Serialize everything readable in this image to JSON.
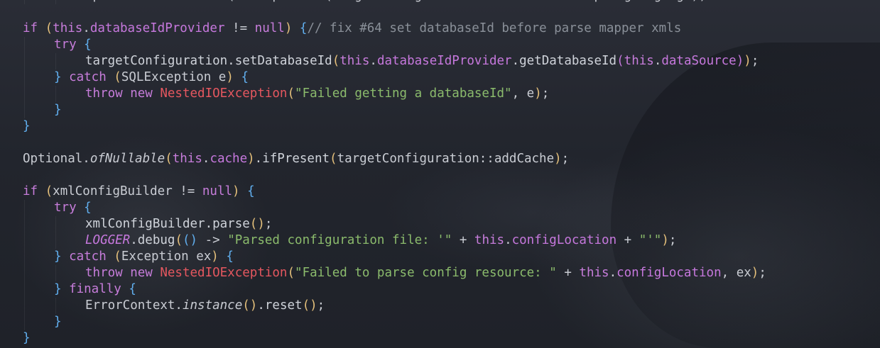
{
  "editor": {
    "lines": [
      {
        "indent": 2,
        "tokens": [
          {
            "t": "Optional.ofNullable(this.",
            "c": "t-plain"
          },
          {
            "t": "present(targetConfiguration::setDefaultScriptingLanguage);",
            "c": "t-plain"
          }
        ]
      },
      {
        "indent": 0,
        "tokens": []
      },
      {
        "indent": 0,
        "tokens": [
          {
            "t": "if ",
            "c": "t-kw"
          },
          {
            "t": "(",
            "c": "p1"
          },
          {
            "t": "this",
            "c": "t-kw"
          },
          {
            "t": ".",
            "c": "t-plain"
          },
          {
            "t": "databaseIdProvider",
            "c": "t-field"
          },
          {
            "t": " != ",
            "c": "t-plain"
          },
          {
            "t": "null",
            "c": "t-kw"
          },
          {
            "t": ") ",
            "c": "p1"
          },
          {
            "t": "{",
            "c": "brace"
          },
          {
            "t": "// fix #64 set databaseId before parse mapper xmls",
            "c": "t-comment"
          }
        ]
      },
      {
        "indent": 1,
        "tokens": [
          {
            "t": "try ",
            "c": "t-kw"
          },
          {
            "t": "{",
            "c": "brace"
          }
        ]
      },
      {
        "indent": 2,
        "tokens": [
          {
            "t": "targetConfiguration.setDatabaseId",
            "c": "t-fn"
          },
          {
            "t": "(",
            "c": "p1"
          },
          {
            "t": "this",
            "c": "t-kw"
          },
          {
            "t": ".",
            "c": "t-plain"
          },
          {
            "t": "databaseIdProvider",
            "c": "t-field"
          },
          {
            "t": ".getDatabaseId",
            "c": "t-fn"
          },
          {
            "t": "(",
            "c": "p2"
          },
          {
            "t": "this",
            "c": "t-kw"
          },
          {
            "t": ".",
            "c": "t-plain"
          },
          {
            "t": "dataSource",
            "c": "t-field"
          },
          {
            "t": ")",
            "c": "p2"
          },
          {
            "t": ")",
            "c": "p1"
          },
          {
            "t": ";",
            "c": "t-plain"
          }
        ]
      },
      {
        "indent": 1,
        "tokens": [
          {
            "t": "} ",
            "c": "brace"
          },
          {
            "t": "catch ",
            "c": "t-kw"
          },
          {
            "t": "(",
            "c": "p1"
          },
          {
            "t": "SQLException e",
            "c": "t-plain"
          },
          {
            "t": ") ",
            "c": "p1"
          },
          {
            "t": "{",
            "c": "brace"
          }
        ]
      },
      {
        "indent": 2,
        "tokens": [
          {
            "t": "throw new ",
            "c": "t-kw"
          },
          {
            "t": "NestedIOException",
            "c": "t-cls"
          },
          {
            "t": "(",
            "c": "p1"
          },
          {
            "t": "\"Failed getting a databaseId\"",
            "c": "t-str"
          },
          {
            "t": ", e",
            "c": "t-plain"
          },
          {
            "t": ")",
            "c": "p1"
          },
          {
            "t": ";",
            "c": "t-plain"
          }
        ]
      },
      {
        "indent": 1,
        "tokens": [
          {
            "t": "}",
            "c": "brace"
          }
        ]
      },
      {
        "indent": 0,
        "tokens": [
          {
            "t": "}",
            "c": "brace"
          }
        ]
      },
      {
        "indent": 0,
        "tokens": []
      },
      {
        "indent": 0,
        "tokens": [
          {
            "t": "Optional.",
            "c": "t-plain"
          },
          {
            "t": "ofNullable",
            "c": "t-static"
          },
          {
            "t": "(",
            "c": "p1"
          },
          {
            "t": "this",
            "c": "t-kw"
          },
          {
            "t": ".",
            "c": "t-plain"
          },
          {
            "t": "cache",
            "c": "t-field"
          },
          {
            "t": ")",
            "c": "p1"
          },
          {
            "t": ".ifPresent",
            "c": "t-fn"
          },
          {
            "t": "(",
            "c": "p1"
          },
          {
            "t": "targetConfiguration::addCache",
            "c": "t-plain"
          },
          {
            "t": ")",
            "c": "p1"
          },
          {
            "t": ";",
            "c": "t-plain"
          }
        ]
      },
      {
        "indent": 0,
        "tokens": []
      },
      {
        "indent": 0,
        "tokens": [
          {
            "t": "if ",
            "c": "t-kw"
          },
          {
            "t": "(",
            "c": "p1"
          },
          {
            "t": "xmlConfigBuilder != ",
            "c": "t-plain"
          },
          {
            "t": "null",
            "c": "t-kw"
          },
          {
            "t": ") ",
            "c": "p1"
          },
          {
            "t": "{",
            "c": "brace"
          }
        ]
      },
      {
        "indent": 1,
        "tokens": [
          {
            "t": "try ",
            "c": "t-kw"
          },
          {
            "t": "{",
            "c": "brace"
          }
        ]
      },
      {
        "indent": 2,
        "tokens": [
          {
            "t": "xmlConfigBuilder.parse",
            "c": "t-fn"
          },
          {
            "t": "()",
            "c": "p1"
          },
          {
            "t": ";",
            "c": "t-plain"
          }
        ]
      },
      {
        "indent": 2,
        "tokens": [
          {
            "t": "LOGGER",
            "c": "t-const"
          },
          {
            "t": ".debug",
            "c": "t-fn"
          },
          {
            "t": "(",
            "c": "p1"
          },
          {
            "t": "()",
            "c": "p3"
          },
          {
            "t": " -> ",
            "c": "t-plain"
          },
          {
            "t": "\"Parsed configuration file: '\"",
            "c": "t-str"
          },
          {
            "t": " + ",
            "c": "t-plain"
          },
          {
            "t": "this",
            "c": "t-kw"
          },
          {
            "t": ".",
            "c": "t-plain"
          },
          {
            "t": "configLocation",
            "c": "t-field"
          },
          {
            "t": " + ",
            "c": "t-plain"
          },
          {
            "t": "\"'\"",
            "c": "t-str"
          },
          {
            "t": ")",
            "c": "p1"
          },
          {
            "t": ";",
            "c": "t-plain"
          }
        ]
      },
      {
        "indent": 1,
        "tokens": [
          {
            "t": "} ",
            "c": "brace"
          },
          {
            "t": "catch ",
            "c": "t-kw"
          },
          {
            "t": "(",
            "c": "p1"
          },
          {
            "t": "Exception ex",
            "c": "t-plain"
          },
          {
            "t": ") ",
            "c": "p1"
          },
          {
            "t": "{",
            "c": "brace"
          }
        ]
      },
      {
        "indent": 2,
        "tokens": [
          {
            "t": "throw new ",
            "c": "t-kw"
          },
          {
            "t": "NestedIOException",
            "c": "t-cls"
          },
          {
            "t": "(",
            "c": "p1"
          },
          {
            "t": "\"Failed to parse config resource: \"",
            "c": "t-str"
          },
          {
            "t": " + ",
            "c": "t-plain"
          },
          {
            "t": "this",
            "c": "t-kw"
          },
          {
            "t": ".",
            "c": "t-plain"
          },
          {
            "t": "configLocation",
            "c": "t-field"
          },
          {
            "t": ", ex",
            "c": "t-plain"
          },
          {
            "t": ")",
            "c": "p1"
          },
          {
            "t": ";",
            "c": "t-plain"
          }
        ]
      },
      {
        "indent": 1,
        "tokens": [
          {
            "t": "} ",
            "c": "brace"
          },
          {
            "t": "finally ",
            "c": "t-kw"
          },
          {
            "t": "{",
            "c": "brace"
          }
        ]
      },
      {
        "indent": 2,
        "tokens": [
          {
            "t": "ErrorContext.",
            "c": "t-plain"
          },
          {
            "t": "instance",
            "c": "t-static"
          },
          {
            "t": "()",
            "c": "p1"
          },
          {
            "t": ".reset",
            "c": "t-fn"
          },
          {
            "t": "()",
            "c": "p1"
          },
          {
            "t": ";",
            "c": "t-plain"
          }
        ]
      },
      {
        "indent": 1,
        "tokens": [
          {
            "t": "}",
            "c": "brace"
          }
        ]
      },
      {
        "indent": 0,
        "tokens": [
          {
            "t": "}",
            "c": "brace"
          }
        ]
      }
    ]
  }
}
